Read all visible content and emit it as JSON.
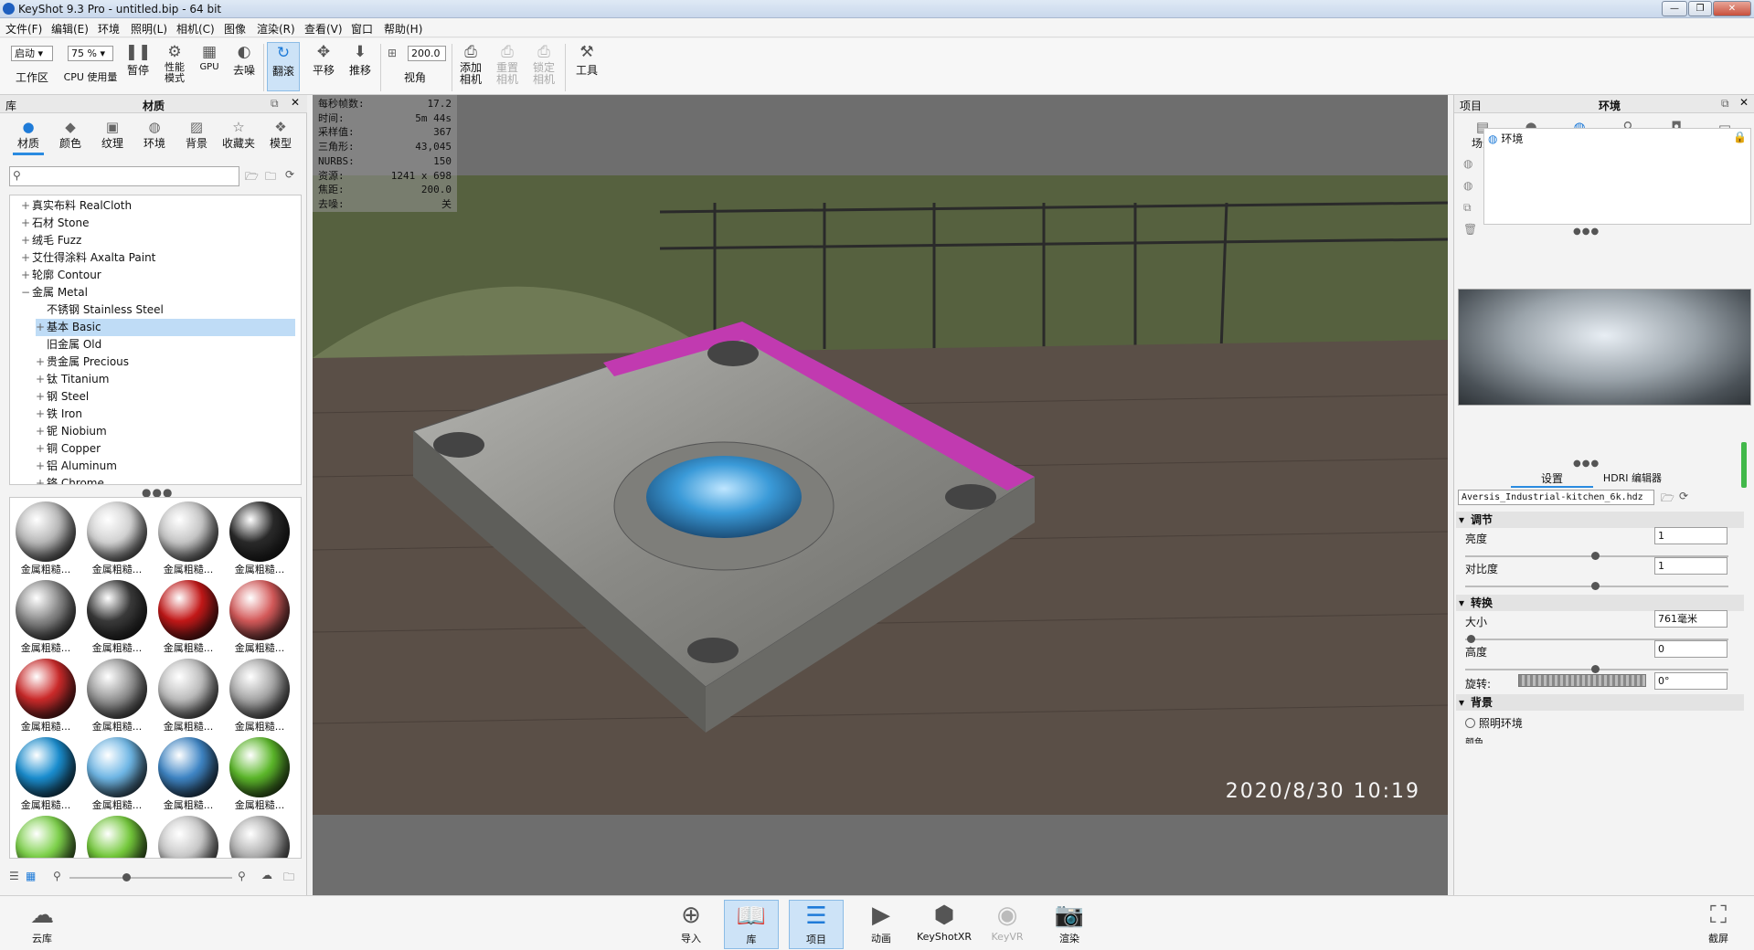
{
  "window": {
    "title": "KeyShot 9.3 Pro  - untitled.bip  - 64 bit"
  },
  "menu": [
    "文件(F)",
    "编辑(E)",
    "环境",
    "照明(L)",
    "相机(C)",
    "图像",
    "渲染(R)",
    "查看(V)",
    "窗口",
    "帮助(H)"
  ],
  "toolbar": {
    "workspace_select": "启动",
    "workspace_label": "工作区",
    "cpu_select": "75 %",
    "cpu_label": "CPU 使用量",
    "pause": "暂停",
    "perf_label": "性能\n模式",
    "gpu": "GPU",
    "denoise": "去噪",
    "tumble": "翻滚",
    "pan": "平移",
    "dolly": "推移",
    "fov_value": "200.0",
    "fov_label": "视角",
    "add_camera": "添加\n相机",
    "reset_camera": "重置\n相机",
    "lock_camera": "锁定\n相机",
    "tools": "工具"
  },
  "library": {
    "header": "库",
    "panel_title": "材质",
    "tabs": [
      "材质",
      "颜色",
      "纹理",
      "环境",
      "背景",
      "收藏夹",
      "模型"
    ],
    "active_tab": 0,
    "tree": [
      {
        "label": "真实布料 RealCloth",
        "level": 0,
        "exp": "+"
      },
      {
        "label": "石材 Stone",
        "level": 0,
        "exp": "+"
      },
      {
        "label": "绒毛 Fuzz",
        "level": 0,
        "exp": "+"
      },
      {
        "label": "艾仕得涂料 Axalta Paint",
        "level": 0,
        "exp": "+"
      },
      {
        "label": "轮廓 Contour",
        "level": 0,
        "exp": "+"
      },
      {
        "label": "金属 Metal",
        "level": 0,
        "exp": "−"
      },
      {
        "label": "不锈钢 Stainless Steel",
        "level": 1,
        "exp": ""
      },
      {
        "label": "基本 Basic",
        "level": 1,
        "exp": "+",
        "selected": true
      },
      {
        "label": "旧金属 Old",
        "level": 1,
        "exp": ""
      },
      {
        "label": "贵金属 Precious",
        "level": 1,
        "exp": "+"
      },
      {
        "label": "钛 Titanium",
        "level": 1,
        "exp": "+"
      },
      {
        "label": "钢 Steel",
        "level": 1,
        "exp": "+"
      },
      {
        "label": "铁 Iron",
        "level": 1,
        "exp": "+"
      },
      {
        "label": "铌 Niobium",
        "level": 1,
        "exp": "+"
      },
      {
        "label": "铜 Copper",
        "level": 1,
        "exp": "+"
      },
      {
        "label": "铝 Aluminum",
        "level": 1,
        "exp": "+"
      },
      {
        "label": "铬 Chrome",
        "level": 1,
        "exp": "+"
      }
    ],
    "thumb_label": "金属粗糙...",
    "thumb_colors": [
      "#b9b9b9",
      "#d2d2d2",
      "#c6c6c6",
      "#2a2a2a",
      "#8a8a8a",
      "#3a3a3a",
      "#c41818",
      "#d55a5a",
      "#cc2a2a",
      "#9a9a9a",
      "#bdbdbd",
      "#a9a9a9",
      "#1a8ed0",
      "#6fb7e6",
      "#3f86c6",
      "#5cb82a",
      "#7dd14a",
      "#74c93b",
      "#c8c8c8",
      "#aeaeae"
    ]
  },
  "hud": [
    {
      "k": "每秒帧数:",
      "v": "17.2"
    },
    {
      "k": "时间:",
      "v": "5m 44s"
    },
    {
      "k": "采样值:",
      "v": "367"
    },
    {
      "k": "三角形:",
      "v": "43,045"
    },
    {
      "k": "NURBS:",
      "v": "150"
    },
    {
      "k": "资源:",
      "v": "1241 x 698"
    },
    {
      "k": "焦距:",
      "v": "200.0"
    },
    {
      "k": "去噪:",
      "v": "关"
    }
  ],
  "viewport": {
    "datetime": "2020/8/30  10:19"
  },
  "project": {
    "header": "项目",
    "panel_title": "环境",
    "tabs": [
      "场景",
      "材质",
      "环境",
      "照明",
      "相机",
      "图像"
    ],
    "active_tab": 2,
    "env_item": "环境",
    "subtabs": [
      "设置",
      "HDRI 编辑器"
    ],
    "hdri_file": "Aversis_Industrial-kitchen_6k.hdz",
    "sections": {
      "adjust": "调节",
      "transform": "转换",
      "background": "背景"
    },
    "brightness_label": "亮度",
    "brightness_value": "1",
    "contrast_label": "对比度",
    "contrast_value": "1",
    "size_label": "大小",
    "size_value": "761毫米",
    "height_label": "高度",
    "height_value": "0",
    "rotation_label": "旋转:",
    "rotation_value": "0°",
    "bg_option1": "照明环境",
    "bg_option2": "颜色"
  },
  "bottom": {
    "cloud": "云库",
    "items": [
      "导入",
      "库",
      "项目",
      "动画",
      "KeyShotXR",
      "KeyVR",
      "渲染"
    ],
    "screenshot": "截屏"
  }
}
